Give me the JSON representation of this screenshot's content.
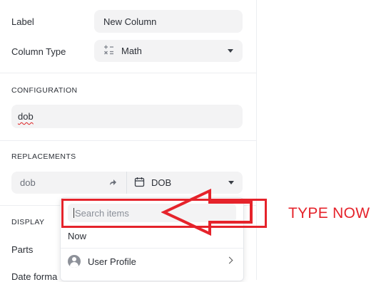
{
  "form": {
    "label_label": "Label",
    "label_value": "New Column",
    "column_type_label": "Column Type",
    "column_type_value": "Math",
    "configuration_title": "CONFIGURATION",
    "configuration_value": "dob",
    "replacements_title": "REPLACEMENTS",
    "replacement_from": "dob",
    "replacement_to": "DOB",
    "display_title": "DISPLAY",
    "parts_label": "Parts",
    "date_format_label": "Date forma"
  },
  "dropdown": {
    "search_placeholder": "Search items",
    "items": [
      {
        "label": "Now"
      },
      {
        "label": "User Profile"
      }
    ]
  },
  "annotation": {
    "text": "TYPE NOW",
    "color": "#e5232b"
  },
  "icons": {
    "column_type": "math-operators-icon",
    "arrow": "arrow-right-icon",
    "calendar": "calendar-icon",
    "avatar": "user-avatar-icon",
    "chevron": "chevron-right-icon"
  }
}
